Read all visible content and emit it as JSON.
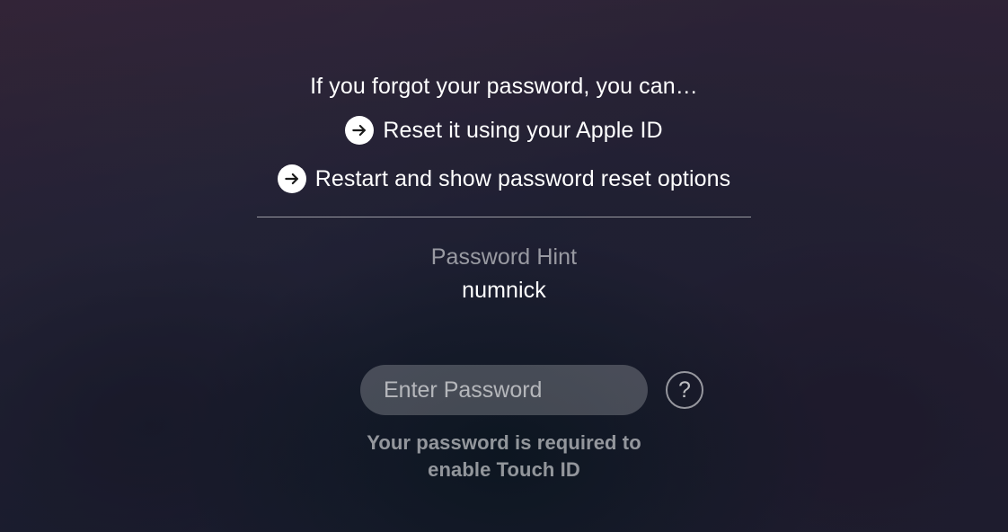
{
  "forgot": {
    "heading": "If you forgot your password, you can…",
    "options": [
      {
        "label": "Reset it using your Apple ID"
      },
      {
        "label": "Restart and show password reset options"
      }
    ]
  },
  "hint": {
    "label": "Password Hint",
    "value": "numnick"
  },
  "password": {
    "placeholder": "Enter Password",
    "value": "",
    "required_line1": "Your password is required to",
    "required_line2": "enable Touch ID"
  }
}
